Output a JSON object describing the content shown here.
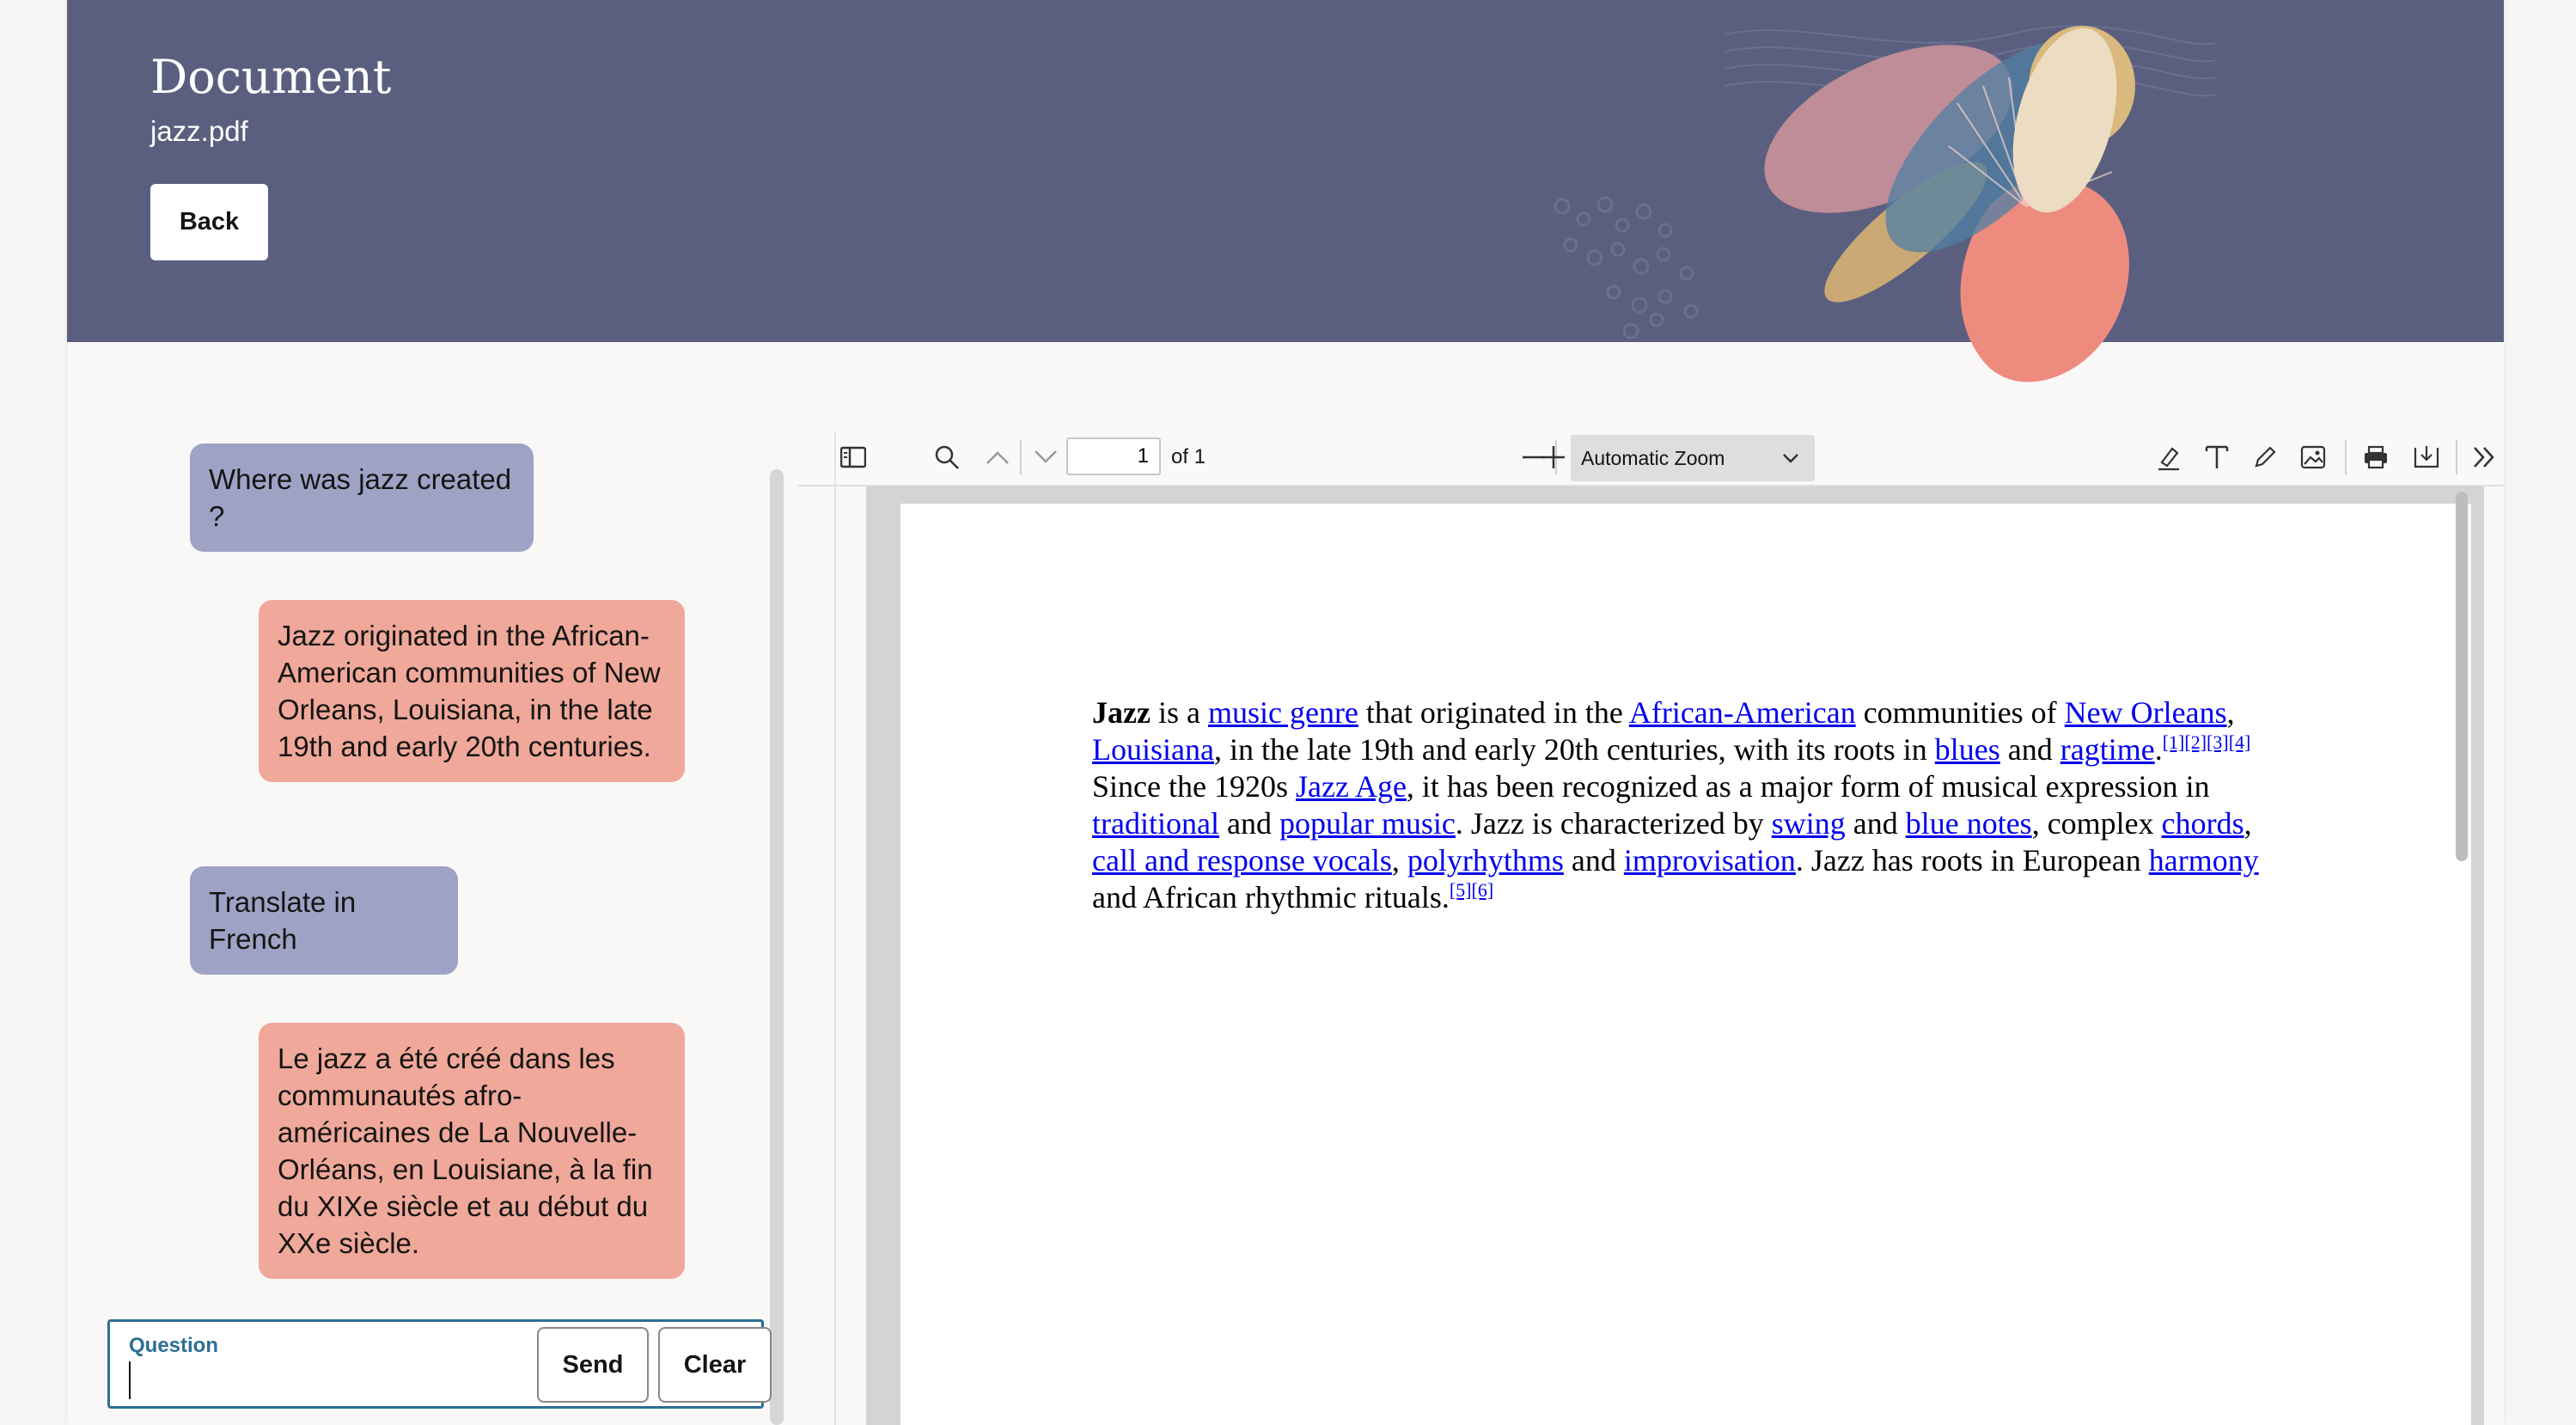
{
  "header": {
    "title": "Document",
    "filename": "jazz.pdf",
    "back_label": "Back"
  },
  "chat": {
    "messages": [
      {
        "role": "user",
        "text": "Where was jazz created ?"
      },
      {
        "role": "assistant",
        "text": "Jazz originated in the African-American communities of New Orleans, Louisiana, in the late 19th and early 20th centuries."
      },
      {
        "role": "user",
        "text": "Translate in French"
      },
      {
        "role": "assistant",
        "text": "Le jazz a été créé dans les communautés afro-américaines de La Nouvelle-Orléans, en Louisiane, à la fin du XIXe siècle et au début du XXe siècle."
      }
    ],
    "question_label": "Question",
    "question_value": "",
    "send_label": "Send",
    "clear_label": "Clear"
  },
  "viewer": {
    "page_number": "1",
    "page_count": "of 1",
    "zoom": "Automatic Zoom",
    "icons": [
      "sidebar-toggle-icon",
      "search-icon",
      "chevron-up-icon",
      "chevron-down-icon",
      "minus-icon",
      "plus-icon",
      "highlight-icon",
      "text-icon",
      "draw-icon",
      "image-icon",
      "print-icon",
      "download-icon",
      "double-chevron-right-icon"
    ]
  },
  "pdf": {
    "segments": [
      {
        "t": "Jazz",
        "bold": true
      },
      {
        "t": " is a "
      },
      {
        "t": "music genre",
        "link": true
      },
      {
        "t": " that originated in the "
      },
      {
        "t": "African-American",
        "link": true
      },
      {
        "t": " communities of "
      },
      {
        "t": "New Orleans",
        "link": true
      },
      {
        "t": ", "
      },
      {
        "t": "Louisiana",
        "link": true
      },
      {
        "t": ", in the late 19th and early 20th centuries, with its roots in "
      },
      {
        "t": "blues",
        "link": true
      },
      {
        "t": " and "
      },
      {
        "t": "ragtime",
        "link": true
      },
      {
        "t": "."
      },
      {
        "t": "[1][2][3][4]",
        "sup": true
      },
      {
        "t": " Since the 1920s "
      },
      {
        "t": "Jazz Age",
        "link": true
      },
      {
        "t": ", it has been recognized as a major form of musical expression in "
      },
      {
        "t": "traditional",
        "link": true
      },
      {
        "t": " and "
      },
      {
        "t": "popular music",
        "link": true
      },
      {
        "t": ". Jazz is characterized by "
      },
      {
        "t": "swing",
        "link": true
      },
      {
        "t": " and "
      },
      {
        "t": "blue notes",
        "link": true
      },
      {
        "t": ", complex "
      },
      {
        "t": "chords",
        "link": true
      },
      {
        "t": ", "
      },
      {
        "t": "call and response vocals",
        "link": true
      },
      {
        "t": ", "
      },
      {
        "t": "polyrhythms",
        "link": true
      },
      {
        "t": " and "
      },
      {
        "t": "improvisation",
        "link": true
      },
      {
        "t": ". Jazz has roots in European "
      },
      {
        "t": "harmony",
        "link": true
      },
      {
        "t": " and African rhythmic rituals."
      },
      {
        "t": "[5][6]",
        "sup": true
      }
    ]
  },
  "colors": {
    "banner": "#5b5f7f",
    "user_bubble": "#9ea3c6",
    "assistant_bubble": "#efa89a",
    "focus": "#2a6f95",
    "link": "#0000ee"
  }
}
